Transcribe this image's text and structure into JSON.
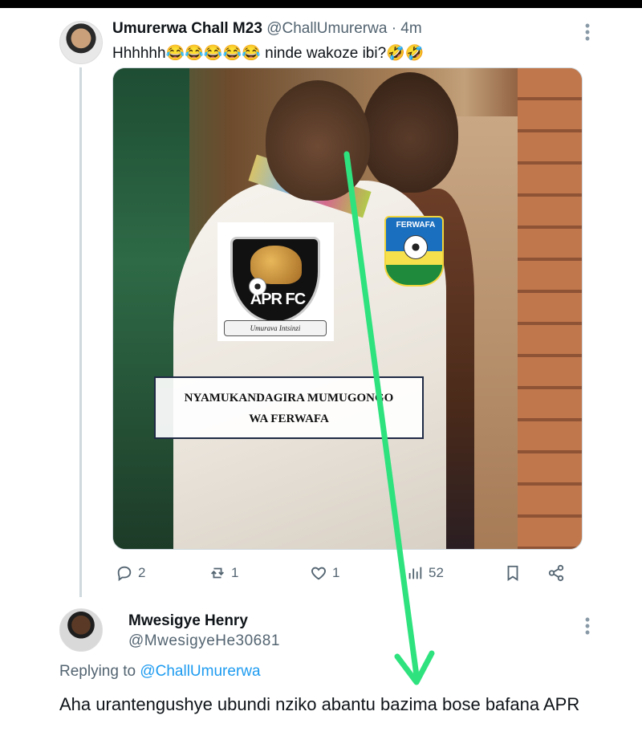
{
  "tweet": {
    "author_name": "Umurerwa Chall M23",
    "author_handle": "@ChallUmurerwa",
    "separator": "·",
    "time": "4m",
    "text": "Hhhhhh😂😂😂😂😂 ninde wakoze ibi?🤣🤣",
    "media": {
      "apr_logo_text": "APR FC",
      "apr_ribbon_text": "Umurava Intsinzi",
      "ferwafa_logo_text": "FERWAFA",
      "caption_line1": "NYAMUKANDAGIRA MUMUGONGO",
      "caption_line2": "WA FERWAFA"
    },
    "actions": {
      "replies": "2",
      "retweets": "1",
      "likes": "1",
      "views": "52"
    }
  },
  "reply": {
    "author_name": "Mwesigye Henry",
    "author_handle": "@MwesigyeHe30681",
    "replying_prefix": "Replying to",
    "replying_handle": "@ChallUmurerwa",
    "text": "Aha urantengushye ubundi nziko abantu bazima bose bafana APR"
  },
  "colors": {
    "link": "#1d9bf0",
    "muted": "#536471",
    "arrow": "#2ee37e"
  },
  "icons": [
    "more-vertical-icon",
    "reply-icon",
    "retweet-icon",
    "like-icon",
    "views-icon",
    "bookmark-icon",
    "share-icon"
  ]
}
